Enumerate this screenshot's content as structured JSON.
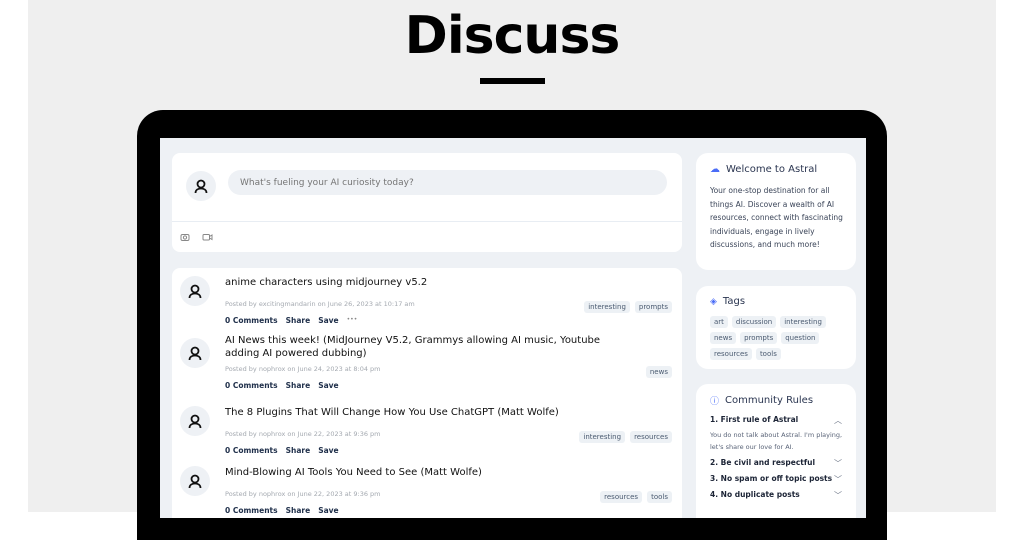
{
  "page_title": "Discuss",
  "composer": {
    "placeholder": "What's fueling your AI curiosity today?"
  },
  "posts": [
    {
      "title": "anime characters using midjourney v5.2",
      "meta": "Posted by excitingmandarin on June 26, 2023 at 10:17 am",
      "comments": "0 Comments",
      "share": "Share",
      "save": "Save",
      "more": "•••",
      "tags": [
        "interesting",
        "prompts"
      ]
    },
    {
      "title": "AI News this week! (MidJourney V5.2, Grammys allowing AI music, Youtube adding AI powered dubbing)",
      "meta": "Posted by nophrox on June 24, 2023 at 8:04 pm",
      "comments": "0 Comments",
      "share": "Share",
      "save": "Save",
      "tags": [
        "news"
      ]
    },
    {
      "title": "The 8 Plugins That Will Change How You Use ChatGPT (Matt Wolfe)",
      "meta": "Posted by nophrox on June 22, 2023 at 9:36 pm",
      "comments": "0 Comments",
      "share": "Share",
      "save": "Save",
      "tags": [
        "interesting",
        "resources"
      ]
    },
    {
      "title": "Mind-Blowing AI Tools You Need to See (Matt Wolfe)",
      "meta": "Posted by nophrox on June 22, 2023 at 9:36 pm",
      "comments": "0 Comments",
      "share": "Share",
      "save": "Save",
      "tags": [
        "resources",
        "tools"
      ]
    }
  ],
  "sidebar": {
    "welcome": {
      "title": "Welcome to Astral",
      "text": "Your one-stop destination for all things AI. Discover a wealth of AI resources, connect with fascinating individuals, engage in lively discussions, and much more!"
    },
    "tags": {
      "title": "Tags",
      "items": [
        "art",
        "discussion",
        "interesting",
        "news",
        "prompts",
        "question",
        "resources",
        "tools"
      ]
    },
    "rules": {
      "title": "Community Rules",
      "items": [
        {
          "label": "1. First rule of Astral",
          "expanded": true,
          "body": "You do not talk about Astral. I'm playing, let's share our love for AI."
        },
        {
          "label": "2. Be civil and respectful",
          "expanded": false
        },
        {
          "label": "3. No spam or off topic posts",
          "expanded": false
        },
        {
          "label": "4. No duplicate posts",
          "expanded": false
        }
      ]
    }
  },
  "colors": {
    "accent": "#4a6cf7",
    "screen_bg": "#eef1f5"
  }
}
